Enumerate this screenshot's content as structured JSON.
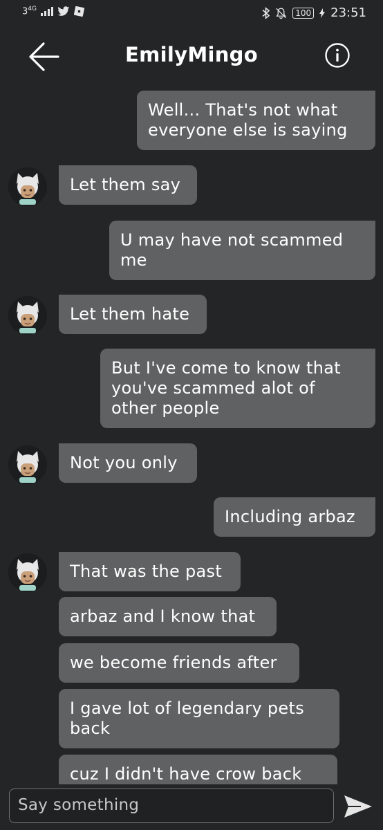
{
  "status_bar": {
    "carrier": "3",
    "network": "4G",
    "battery": "100",
    "time": "23:51"
  },
  "header": {
    "title": "EmilyMingo"
  },
  "messages": [
    {
      "side": "sent",
      "text": "Well... That's not what everyone else is saying"
    },
    {
      "side": "received",
      "text": "Let them say"
    },
    {
      "side": "sent",
      "text": "U may have not scammed me"
    },
    {
      "side": "received",
      "text": "Let them hate"
    },
    {
      "side": "sent",
      "text": "But I've come to know that you've scammed alot of other people"
    },
    {
      "side": "received",
      "text": "Not you only"
    },
    {
      "side": "sent",
      "text": "Including arbaz"
    },
    {
      "side": "received",
      "text": "That was the past"
    },
    {
      "side": "received",
      "text": "arbaz and I know that"
    },
    {
      "side": "received",
      "text": "we become friends after"
    },
    {
      "side": "received",
      "text": "I gave lot of legendary pets back"
    },
    {
      "side": "received",
      "text": "cuz I didn't have crow back"
    }
  ],
  "composer": {
    "placeholder": "Say something"
  },
  "icons": {
    "back": "arrow-left-icon",
    "info": "info-icon",
    "send": "send-icon",
    "avatar": "avatar"
  },
  "colors": {
    "background": "#232527",
    "bubble": "#606162",
    "text": "#ffffff"
  }
}
